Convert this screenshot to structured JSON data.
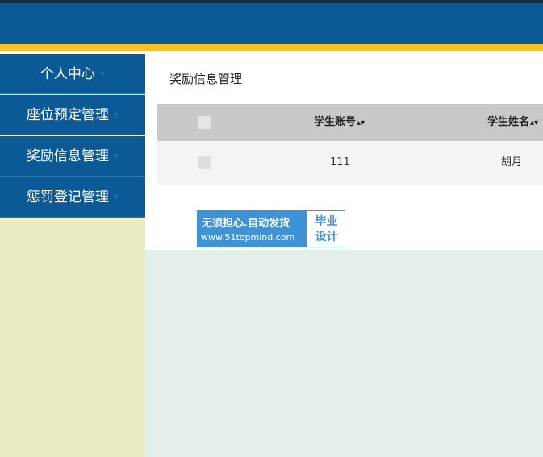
{
  "colors": {
    "header": "#0b5a96",
    "stripe": "#f5c230",
    "sidebar_bg": "#ececc4",
    "table_header": "#c9c9c9",
    "badge": "#3e93d6"
  },
  "sidebar": {
    "items": [
      {
        "label": "个人中心",
        "icon": "caret-down-icon"
      },
      {
        "label": "座位预定管理",
        "icon": "caret-down-icon"
      },
      {
        "label": "奖励信息管理",
        "icon": "caret-down-icon"
      },
      {
        "label": "惩罚登记管理",
        "icon": "caret-down-icon"
      }
    ]
  },
  "main": {
    "title": "奖励信息管理",
    "table": {
      "columns": [
        "学生账号",
        "学生姓名"
      ],
      "sort_icon": "sort-icon",
      "rows": [
        {
          "student_account": "111",
          "student_name": "胡月"
        }
      ]
    }
  },
  "watermark": {
    "line1": "无须担心.自动发货",
    "line2": "www.51topmind.com",
    "right1": "毕业",
    "right2": "设计"
  }
}
